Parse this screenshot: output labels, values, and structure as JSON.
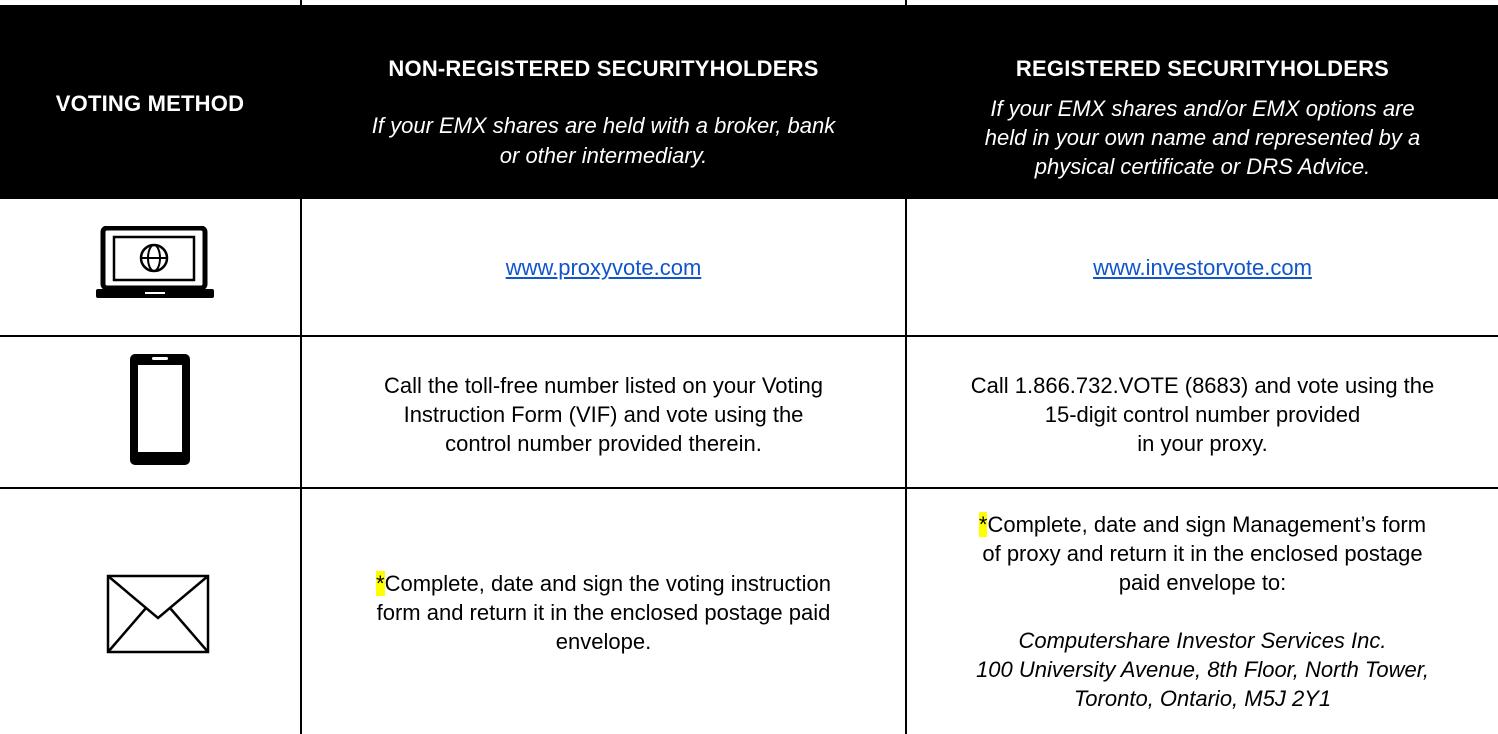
{
  "header": {
    "col1": "VOTING METHOD",
    "col2_title": "NON-REGISTERED SECURITYHOLDERS",
    "col2_sub": [
      "If your EMX shares are held with a broker, bank",
      "or other intermediary."
    ],
    "col3_title": "REGISTERED SECURITYHOLDERS",
    "col3_sub": [
      "If your EMX shares and/or EMX options are",
      "held in your own name and represented by a",
      "physical certificate or DRS Advice."
    ]
  },
  "rows": {
    "internet": {
      "icon": "laptop-globe-icon",
      "non_registered_link": "www.proxyvote.com",
      "registered_link": "www.investorvote.com"
    },
    "phone": {
      "icon": "smartphone-icon",
      "non_registered": [
        "Call the toll-free number listed on your Voting",
        "Instruction Form (VIF) and vote using the",
        "control number provided therein."
      ],
      "registered": [
        "Call 1.866.732.VOTE (8683) and vote using the",
        "15-digit control number provided",
        "in your proxy."
      ]
    },
    "mail": {
      "icon": "envelope-icon",
      "asterisk": "*",
      "non_registered_first": "Complete, date and sign the voting instruction",
      "non_registered_rest": [
        "form and return it in the enclosed postage paid",
        "envelope."
      ],
      "registered_first": "Complete, date and sign Management’s form",
      "registered_rest": [
        "of proxy and return it in the enclosed postage",
        "paid envelope to:"
      ],
      "address": [
        "Computershare Investor Services Inc.",
        "100 University Avenue, 8th Floor, North Tower,",
        "Toronto, Ontario, M5J 2Y1"
      ]
    }
  },
  "colors": {
    "header_bg": "#000000",
    "link": "#1155cc",
    "highlight": "#ffff00"
  }
}
